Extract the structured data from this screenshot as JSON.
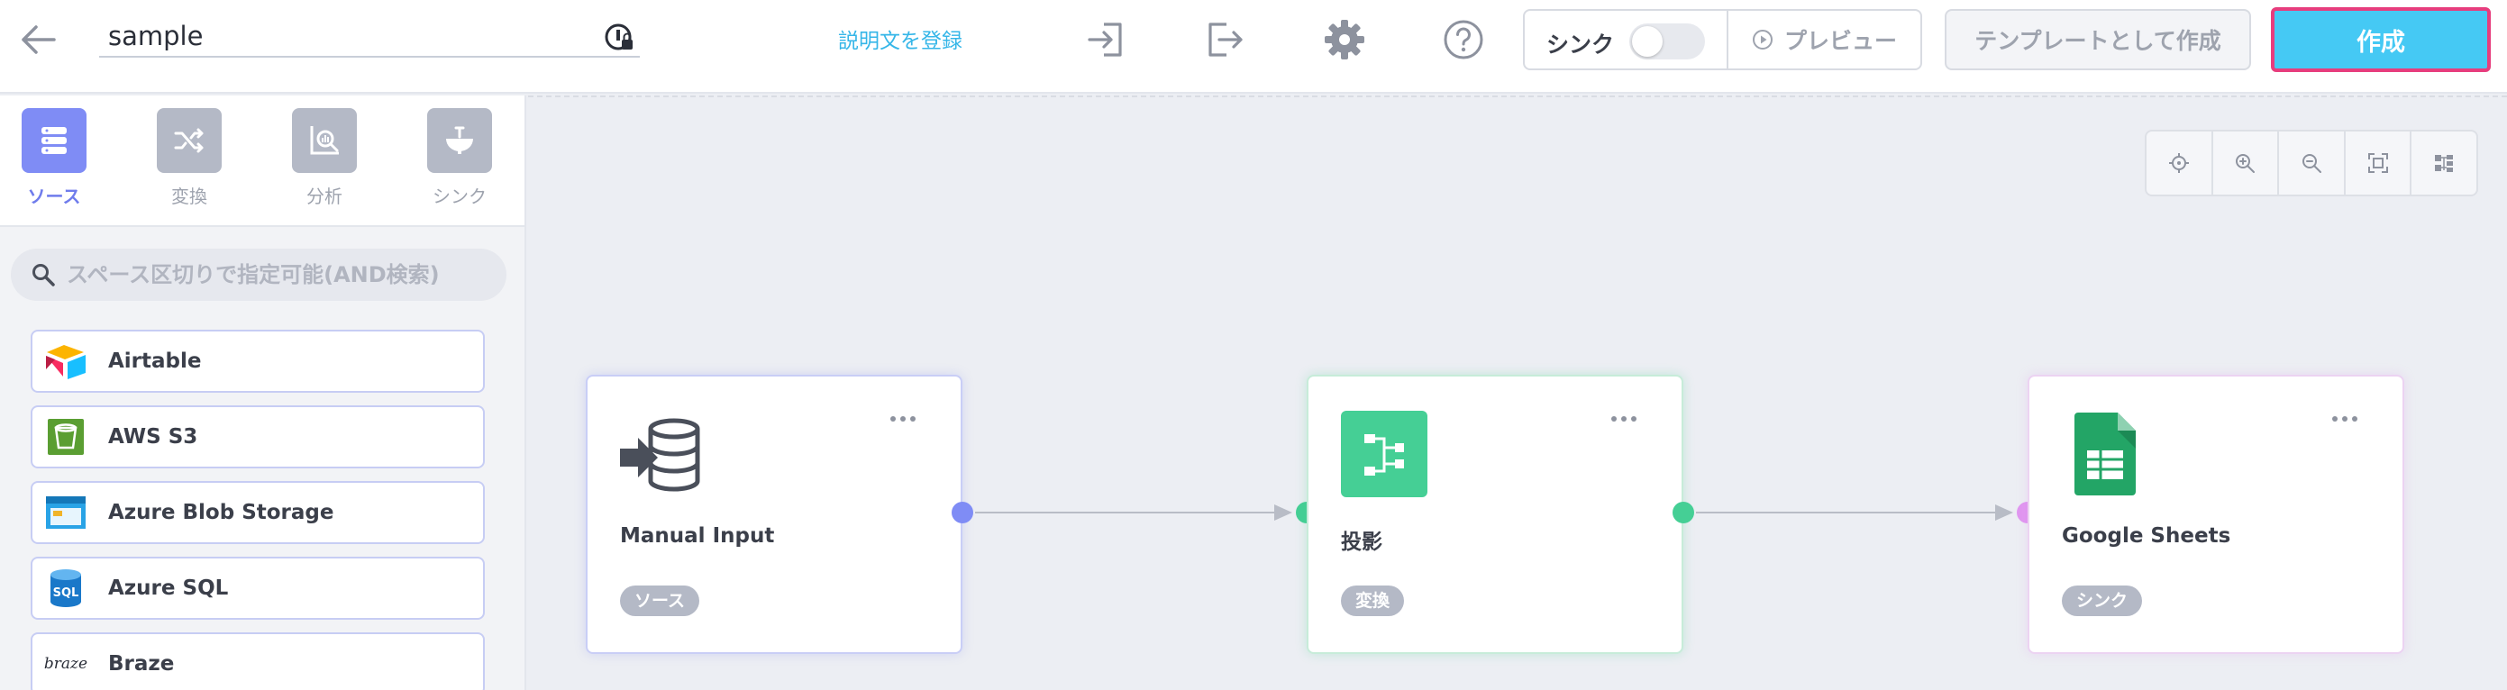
{
  "topbar": {
    "back_icon": "arrow-left-icon",
    "pipeline_name": "sample",
    "lock_icon": "info-lock-icon",
    "description_link": "説明文を登録",
    "icons": [
      "import-icon",
      "export-icon",
      "gear-icon",
      "help-icon"
    ],
    "sync_label": "シンク",
    "sync_enabled": false,
    "preview_label": "プレビュー",
    "template_label": "テンプレートとして作成",
    "create_label": "作成",
    "colors": {
      "create_bg": "#45c9f4",
      "create_border": "#e73d7d",
      "link": "#35b6e8"
    }
  },
  "sidebar": {
    "tabs": [
      {
        "label": "ソース",
        "icon": "database-icon",
        "active": true
      },
      {
        "label": "変換",
        "icon": "shuffle-icon",
        "active": false
      },
      {
        "label": "分析",
        "icon": "analysis-icon",
        "active": false
      },
      {
        "label": "シンク",
        "icon": "sink-icon",
        "active": false
      }
    ],
    "search_placeholder": "スペース区切りで指定可能(AND検索)",
    "items": [
      {
        "label": "Airtable",
        "icon": "airtable-icon"
      },
      {
        "label": "AWS S3",
        "icon": "aws-s3-icon"
      },
      {
        "label": "Azure Blob Storage",
        "icon": "azure-blob-icon"
      },
      {
        "label": "Azure SQL",
        "icon": "azure-sql-icon"
      },
      {
        "label": "Braze",
        "icon": "braze-icon",
        "logo_text": "braze"
      }
    ]
  },
  "canvas": {
    "zoom_controls": [
      "crosshair-icon",
      "zoom-in-icon",
      "zoom-out-icon",
      "fit-screen-icon",
      "layout-icon"
    ],
    "nodes": [
      {
        "title": "Manual Input",
        "badge": "ソース",
        "icon": "manual-input-icon",
        "accent": "#7f8cf5"
      },
      {
        "title": "投影",
        "badge": "変換",
        "icon": "projection-icon",
        "accent": "#45cf95"
      },
      {
        "title": "Google Sheets",
        "badge": "シンク",
        "icon": "google-sheets-icon",
        "accent": "#e096f0"
      }
    ]
  }
}
